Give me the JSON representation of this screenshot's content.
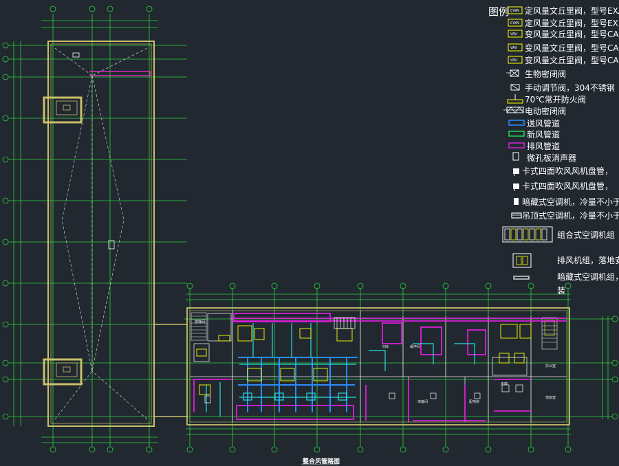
{
  "drawing": {
    "caption": "整合风管路图",
    "colors": {
      "background": "#212830",
      "grid": "#2ed13a",
      "wall": "#c9c06a",
      "supply_duct": "#2a8cff",
      "fresh_duct": "#1fd64a",
      "exhaust_duct": "#d81fd8",
      "equipment": "#ffff00",
      "cyan": "#27e0e0",
      "magenta": "#ff2ad4",
      "white": "#ffffff"
    },
    "room_labels": [
      "楼梯间",
      "冷库",
      "缓冲间",
      "准备间",
      "配电房",
      "走廊",
      "办公室",
      "值班室"
    ]
  },
  "legend": {
    "title": "图例",
    "items": [
      {
        "symbol": "box-tag",
        "tag": "CVAV",
        "text": "定风量文丘里阀，型号EXA"
      },
      {
        "symbol": "box-tag",
        "tag": "CVAV",
        "text": "定风量文丘里阀，型号EX"
      },
      {
        "symbol": "box-tag",
        "tag": "VAV",
        "text": "变风量文丘里阀，型号CA"
      },
      {
        "symbol": "box-tag",
        "tag": "VAV",
        "text": "变风量文丘里阀，型号CA"
      },
      {
        "symbol": "box-tag",
        "tag": "VAV",
        "text": "变风量文丘里阀，型号CA"
      },
      {
        "symbol": "bio-damper",
        "text": "生物密闭阀"
      },
      {
        "symbol": "manual-valve",
        "text": "手动调节阀，304不锈钢"
      },
      {
        "symbol": "fire-damper",
        "text": "70℃常开防火阀"
      },
      {
        "symbol": "electric-damper",
        "text": "电动密闭阀"
      },
      {
        "symbol": "supply-duct",
        "text": "送风管道"
      },
      {
        "symbol": "fresh-duct",
        "text": "新风管道"
      },
      {
        "symbol": "exhaust-duct",
        "text": "排风管道"
      },
      {
        "symbol": "silencer",
        "text": "微孔板消声器"
      },
      {
        "symbol": "cassette",
        "text": "卡式四面吹风风机盘管，"
      },
      {
        "symbol": "cassette",
        "text": "卡式四面吹风风机盘管，"
      },
      {
        "symbol": "concealed-ac",
        "text": "暗藏式空调机，冷量不小于"
      },
      {
        "symbol": "ceiling-ac",
        "text": "吊顶式空调机，冷量不小于"
      },
      {
        "symbol": "ahu",
        "text": "组合式空调机组"
      },
      {
        "symbol": "exhaust-unit",
        "text": "排风机组，落地安"
      },
      {
        "symbol": "concealed-unit",
        "text": "暗藏式空调机组，"
      },
      {
        "symbol": "none",
        "text": "装"
      }
    ]
  }
}
